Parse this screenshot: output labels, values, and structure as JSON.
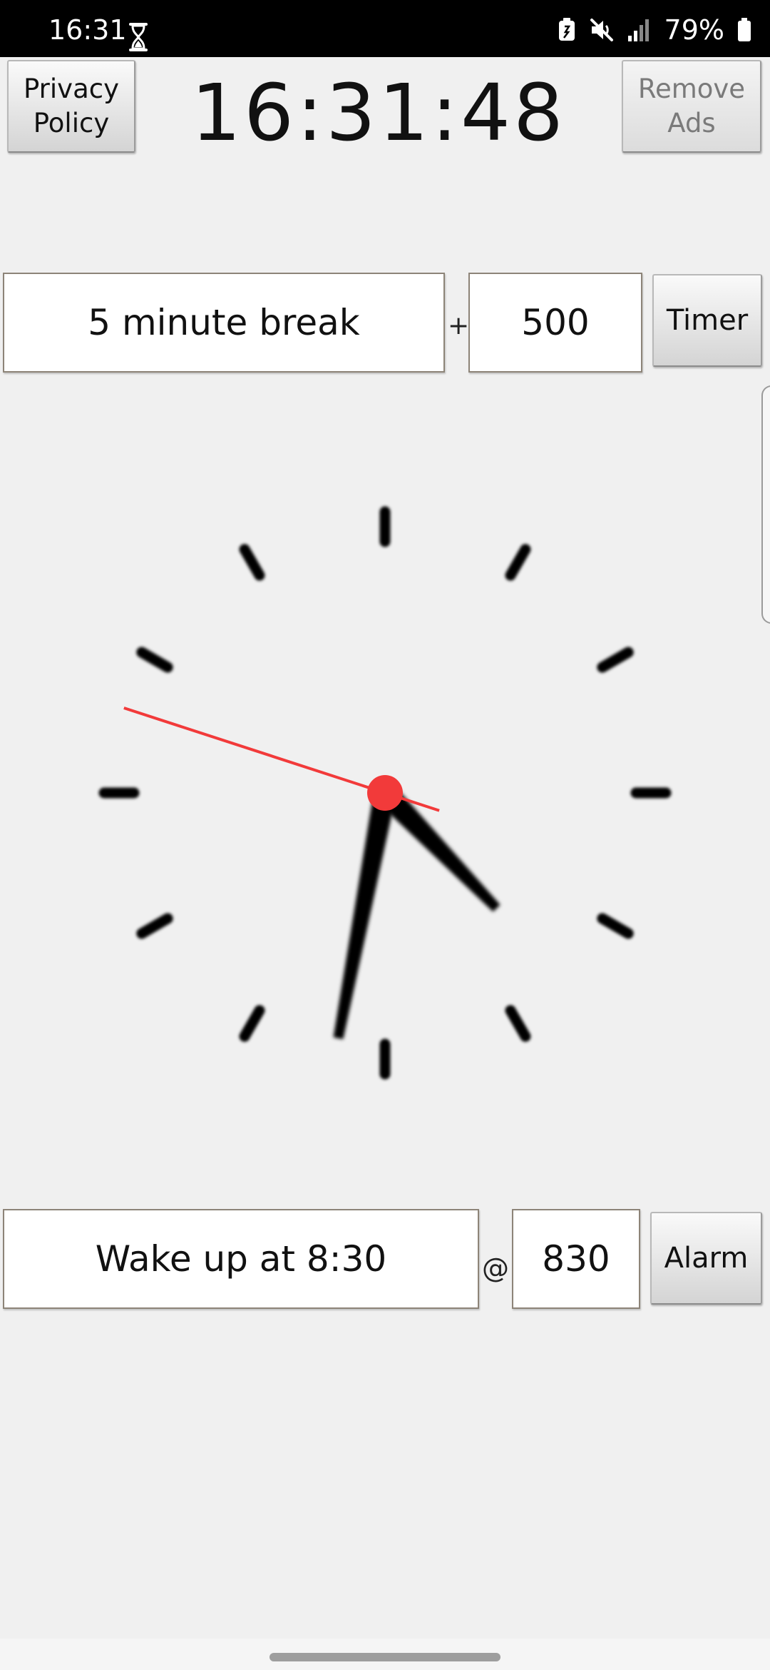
{
  "status_bar": {
    "time": "16:31",
    "battery_percent": "79%",
    "icons": [
      "hourglass-icon",
      "battery-saver-icon",
      "mute-icon",
      "signal-icon",
      "battery-icon"
    ]
  },
  "header": {
    "privacy_label": "Privacy\nPolicy",
    "digital_time": "16:31:48",
    "remove_ads_label": "Remove\nAds"
  },
  "timer": {
    "label_value": "5 minute break",
    "separator": "+",
    "duration_value": "500",
    "button_label": "Timer"
  },
  "clock": {
    "hour": 16,
    "minute": 31,
    "second": 48,
    "colors": {
      "hands": "#000000",
      "second_hand": "#f23a3a",
      "ticks": "#000000"
    }
  },
  "alarm": {
    "label_value": "Wake up at 8:30",
    "separator": "@",
    "time_value": "830",
    "button_label": "Alarm"
  }
}
